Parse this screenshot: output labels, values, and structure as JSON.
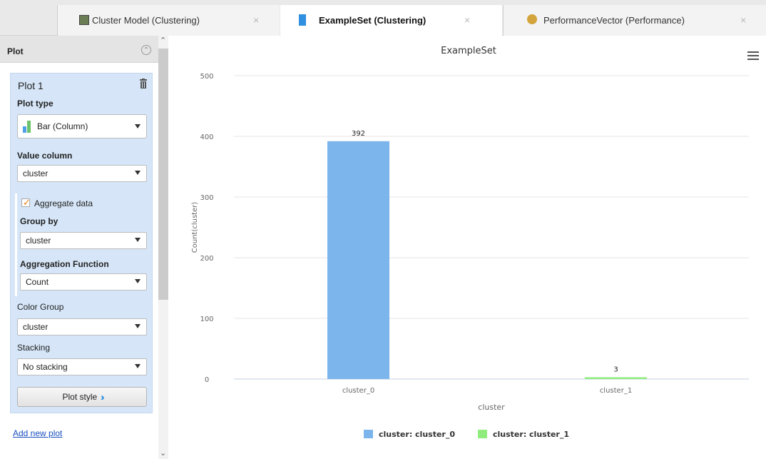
{
  "tabs": [
    {
      "label": "Cluster Model (Clustering)",
      "icon": "cluster-model-icon"
    },
    {
      "label": "ExampleSet (Clustering)",
      "icon": "example-set-icon",
      "active": true
    },
    {
      "label": "PerformanceVector (Performance)",
      "icon": "performance-icon"
    }
  ],
  "tab_close_glyph": "×",
  "panel": {
    "header": "Plot",
    "plot_title": "Plot 1",
    "plot_type_label": "Plot type",
    "plot_type_value": "Bar (Column)",
    "value_column_label": "Value column",
    "value_column_value": "cluster",
    "aggregate_label": "Aggregate data",
    "aggregate_checked": true,
    "group_by_label": "Group by",
    "group_by_value": "cluster",
    "aggregation_function_label": "Aggregation Function",
    "aggregation_function_value": "Count",
    "color_group_label": "Color Group",
    "color_group_value": "cluster",
    "stacking_label": "Stacking",
    "stacking_value": "No stacking",
    "plot_style_button": "Plot style",
    "add_new_plot": "Add new plot"
  },
  "colors": {
    "accent_blue": "#7cb5ec",
    "accent_green": "#90ed7d",
    "panel_blue": "#d6e6f8",
    "checkbox_orange": "#f07c10"
  },
  "chart_data": {
    "type": "bar",
    "title": "ExampleSet",
    "xlabel": "cluster",
    "ylabel": "Count(cluster)",
    "categories": [
      "cluster_0",
      "cluster_1"
    ],
    "values": [
      392,
      3
    ],
    "series_names": [
      "cluster: cluster_0",
      "cluster: cluster_1"
    ],
    "series_colors": [
      "#7cb5ec",
      "#90ed7d"
    ],
    "ylim": [
      0,
      500
    ],
    "yticks": [
      0,
      100,
      200,
      300,
      400,
      500
    ],
    "grid": true,
    "legend_position": "bottom-center"
  }
}
